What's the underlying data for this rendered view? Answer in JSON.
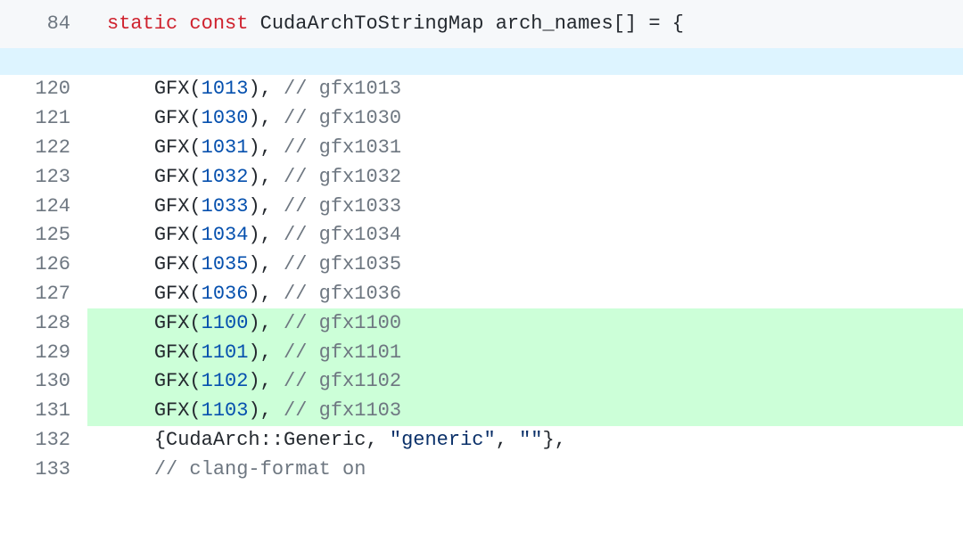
{
  "header": {
    "line_number": "84",
    "kw_static": "static",
    "kw_const": "const",
    "type": "CudaArchToStringMap",
    "var": "arch_names",
    "brackets": "[]",
    "assign_open": " = {"
  },
  "hunk": {
    "text": ""
  },
  "lines": [
    {
      "n": "120",
      "kind": "ctx",
      "macro": "GFX",
      "arg": "1013",
      "tail": ",",
      "comment": "// gfx1013"
    },
    {
      "n": "121",
      "kind": "ctx",
      "macro": "GFX",
      "arg": "1030",
      "tail": ",",
      "comment": "// gfx1030"
    },
    {
      "n": "122",
      "kind": "ctx",
      "macro": "GFX",
      "arg": "1031",
      "tail": ",",
      "comment": "// gfx1031"
    },
    {
      "n": "123",
      "kind": "ctx",
      "macro": "GFX",
      "arg": "1032",
      "tail": ",",
      "comment": "// gfx1032"
    },
    {
      "n": "124",
      "kind": "ctx",
      "macro": "GFX",
      "arg": "1033",
      "tail": ",",
      "comment": "// gfx1033"
    },
    {
      "n": "125",
      "kind": "ctx",
      "macro": "GFX",
      "arg": "1034",
      "tail": ",",
      "comment": "// gfx1034"
    },
    {
      "n": "126",
      "kind": "ctx",
      "macro": "GFX",
      "arg": "1035",
      "tail": ",",
      "comment": "// gfx1035"
    },
    {
      "n": "127",
      "kind": "ctx",
      "macro": "GFX",
      "arg": "1036",
      "tail": ",",
      "comment": "// gfx1036"
    },
    {
      "n": "128",
      "kind": "add",
      "macro": "GFX",
      "arg": "1100",
      "tail": ",",
      "comment": "// gfx1100"
    },
    {
      "n": "129",
      "kind": "add",
      "macro": "GFX",
      "arg": "1101",
      "tail": ",",
      "comment": "// gfx1101"
    },
    {
      "n": "130",
      "kind": "add",
      "macro": "GFX",
      "arg": "1102",
      "tail": ",",
      "comment": "// gfx1102"
    },
    {
      "n": "131",
      "kind": "add",
      "macro": "GFX",
      "arg": "1103",
      "tail": ",",
      "comment": "// gfx1103"
    }
  ],
  "generic_line": {
    "n": "132",
    "open": "{",
    "ns": "CudaArch",
    "scope": "::",
    "member": "Generic",
    "sep1": ", ",
    "str1": "\"generic\"",
    "sep2": ", ",
    "str2": "\"\"",
    "close": "},"
  },
  "trailer": {
    "n": "133",
    "comment": "// clang-format on"
  }
}
